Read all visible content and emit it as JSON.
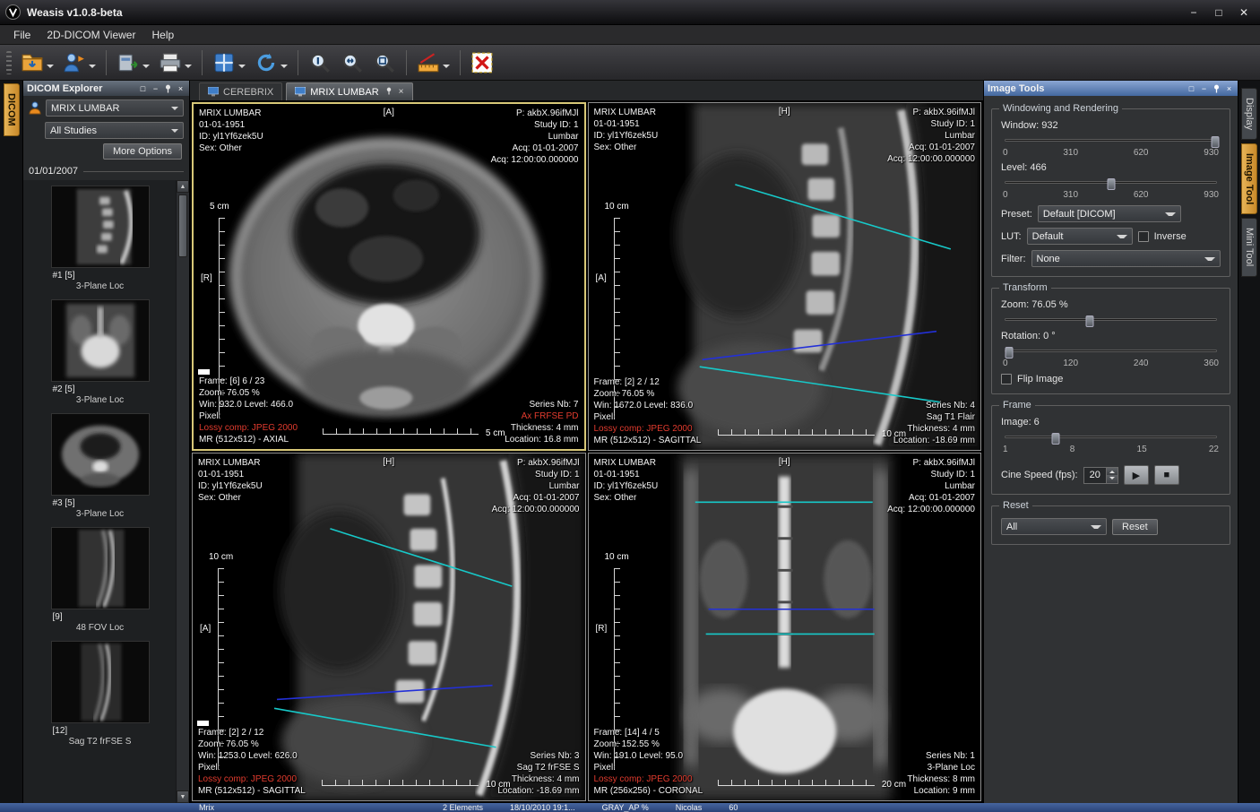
{
  "titlebar": {
    "title": "Weasis v1.0.8-beta"
  },
  "menubar": {
    "items": [
      "File",
      "2D-DICOM Viewer",
      "Help"
    ]
  },
  "toolbar": {
    "tools": [
      "dicom-import",
      "patient-import",
      "dicom-export",
      "print",
      "layout",
      "synchronize",
      "zoom-1-1",
      "zoom-best-fit",
      "magnifier-lens",
      "measurement",
      "delete-selection"
    ]
  },
  "explorer": {
    "tab": "DICOM",
    "title": "DICOM Explorer",
    "patient": "MRIX LUMBAR",
    "studies": "All Studies",
    "more_options": "More Options",
    "date": "01/01/2007",
    "thumbnails": [
      {
        "tag": "#1 [5]",
        "desc": "3-Plane Loc"
      },
      {
        "tag": "#2 [5]",
        "desc": "3-Plane Loc"
      },
      {
        "tag": "#3 [5]",
        "desc": "3-Plane Loc"
      },
      {
        "tag": "[9]",
        "desc": "48 FOV Loc"
      },
      {
        "tag": "[12]",
        "desc": "Sag T2 frFSE S"
      }
    ]
  },
  "tabs": {
    "inactive": "CEREBRIX",
    "active": "MRIX LUMBAR"
  },
  "patient": {
    "left": [
      "MRIX LUMBAR",
      "01-01-1951",
      "ID: yl1Yf6zek5U",
      "Sex: Other"
    ],
    "right": [
      "P: akbX.96ifMJl",
      "Study ID: 1",
      "Lumbar",
      "Acq: 01-01-2007",
      "Acq: 12:00:00.000000"
    ]
  },
  "viewports": [
    {
      "orient_top": "[A]",
      "orient_side": "[R]",
      "vscale": "5 cm",
      "hscale": "5 cm",
      "frame": "Frame: [6] 6 / 23",
      "zoom": "Zoom: 76.05 %",
      "win": "Win: 932.0 Level: 466.0",
      "pixel": "Pixel:",
      "lossy": "Lossy comp: JPEG 2000",
      "modality": "MR (512x512) - AXIAL",
      "series_nb": "Series Nb: 7",
      "series_desc": "Ax FRFSE PD",
      "thickness": "Thickness: 4 mm",
      "location": "Location: 16.8 mm"
    },
    {
      "orient_top": "[H]",
      "orient_side": "[A]",
      "vscale": "10 cm",
      "hscale": "10 cm",
      "frame": "Frame: [2] 2 / 12",
      "zoom": "Zoom: 76.05 %",
      "win": "Win: 1672.0 Level: 836.0",
      "pixel": "Pixel:",
      "lossy": "Lossy comp: JPEG 2000",
      "modality": "MR (512x512) - SAGITTAL",
      "series_nb": "Series Nb: 4",
      "series_desc": "Sag T1 Flair",
      "thickness": "Thickness: 4 mm",
      "location": "Location: -18.69 mm"
    },
    {
      "orient_top": "[H]",
      "orient_side": "[A]",
      "vscale": "10 cm",
      "hscale": "10 cm",
      "frame": "Frame: [2] 2 / 12",
      "zoom": "Zoom: 76.05 %",
      "win": "Win: 1253.0 Level: 626.0",
      "pixel": "Pixel:",
      "lossy": "Lossy comp: JPEG 2000",
      "modality": "MR (512x512) - SAGITTAL",
      "series_nb": "Series Nb: 3",
      "series_desc": "Sag T2 frFSE S",
      "thickness": "Thickness: 4 mm",
      "location": "Location: -18.69 mm"
    },
    {
      "orient_top": "[H]",
      "orient_side": "[R]",
      "vscale": "10 cm",
      "hscale": "20 cm",
      "frame": "Frame: [14] 4 / 5",
      "zoom": "Zoom: 152.55 %",
      "win": "Win: 191.0 Level: 95.0",
      "pixel": "Pixel:",
      "lossy": "Lossy comp: JPEG 2000",
      "modality": "MR (256x256) - CORONAL",
      "series_nb": "Series Nb: 1",
      "series_desc": "3-Plane Loc",
      "thickness": "Thickness: 8 mm",
      "location": "Location: 9 mm"
    }
  ],
  "image_tools": {
    "title": "Image Tools",
    "windowing": {
      "title": "Windowing and Rendering",
      "window_label": "Window: 932",
      "window_ticks": [
        "0",
        "310",
        "620",
        "930"
      ],
      "level_label": "Level: 466",
      "level_ticks": [
        "0",
        "310",
        "620",
        "930"
      ],
      "preset_label": "Preset:",
      "preset_value": "Default [DICOM]",
      "lut_label": "LUT:",
      "lut_value": "Default",
      "inverse_label": "Inverse",
      "filter_label": "Filter:",
      "filter_value": "None"
    },
    "transform": {
      "title": "Transform",
      "zoom_label": "Zoom: 76.05 %",
      "rotation_label": "Rotation: 0 °",
      "rotation_ticks": [
        "0",
        "120",
        "240",
        "360"
      ],
      "flip_label": "Flip Image"
    },
    "frame": {
      "title": "Frame",
      "image_label": "Image: 6",
      "image_ticks": [
        "1",
        "8",
        "15",
        "22"
      ],
      "cine_label": "Cine Speed (fps):",
      "cine_value": "20"
    },
    "reset": {
      "title": "Reset",
      "select_value": "All",
      "button_label": "Reset"
    }
  },
  "right_tabs": [
    "Display",
    "Image Tool",
    "Mini Tool"
  ],
  "statusbar": {
    "items": [
      "Mrix",
      "2 Elements",
      "18/10/2010 19:1...",
      "GRAY_AP %",
      "Nicolas",
      "60"
    ]
  },
  "colors": {
    "accent_amber": "#d99c2b",
    "lossy_red": "#e23b2e",
    "measure_cyan": "#17c9c9",
    "measure_blue": "#2330d8",
    "selected_viewport": "#d8c878"
  }
}
